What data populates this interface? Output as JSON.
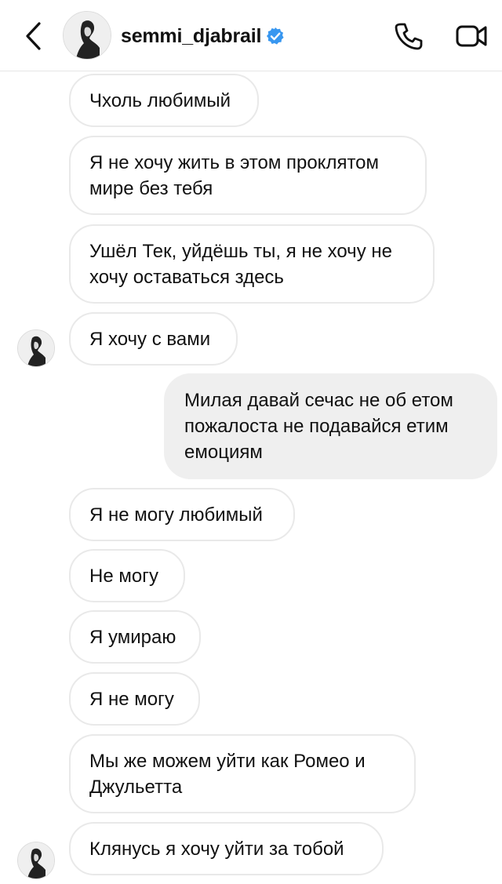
{
  "header": {
    "username": "semmi_djabrail",
    "verified_icon": "verified-badge-icon",
    "back_icon": "chevron-left-icon",
    "call_icon": "phone-icon",
    "video_icon": "video-camera-icon",
    "verified_color": "#3897f0"
  },
  "messages": [
    {
      "from": "them",
      "text": "Чхоль любимый"
    },
    {
      "from": "them",
      "text": "Я не хочу жить в этом проклятом мире без тебя"
    },
    {
      "from": "them",
      "text": "Ушёл Тек, уйдёшь ты, я не хочу не хочу оставаться здесь"
    },
    {
      "from": "them",
      "text": "Я хочу с вами"
    },
    {
      "from": "me",
      "text": "Милая давай сечас не об етом пожалоста не подавайся етим емоциям"
    },
    {
      "from": "them",
      "text": "Я не могу любимый"
    },
    {
      "from": "them",
      "text": "Не могу"
    },
    {
      "from": "them",
      "text": "Я умираю"
    },
    {
      "from": "them",
      "text": "Я не могу"
    },
    {
      "from": "them",
      "text": "Мы же можем уйти как Ромео и Джульетта"
    },
    {
      "from": "them",
      "text": "Клянусь я хочу уйти за тобой"
    }
  ],
  "colors": {
    "incoming_bubble_bg": "#ffffff",
    "incoming_bubble_border": "#e9e9e9",
    "outgoing_bubble_bg": "#efefef",
    "text": "#111111"
  }
}
